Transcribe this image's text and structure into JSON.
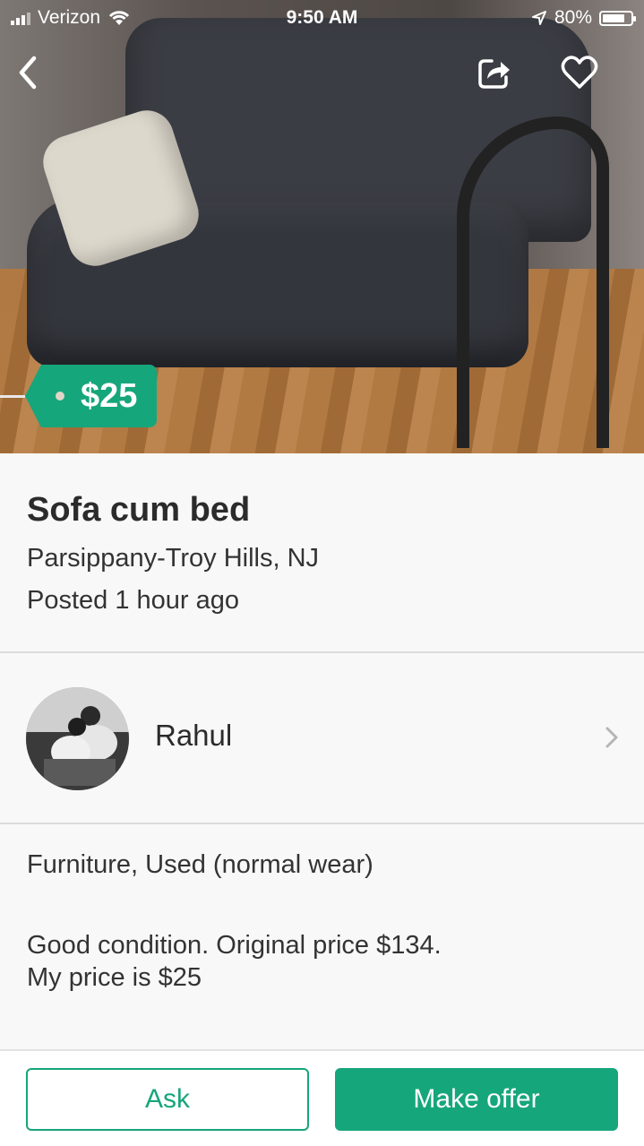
{
  "status_bar": {
    "carrier": "Verizon",
    "time": "9:50 AM",
    "battery_percent": "80%",
    "battery_level": 0.8
  },
  "nav": {
    "back_icon": "chevron-left-icon",
    "share_icon": "share-icon",
    "favorite_icon": "heart-icon"
  },
  "listing": {
    "price": "$25",
    "title": "Sofa cum bed",
    "location": "Parsippany-Troy Hills, NJ",
    "posted": "Posted 1 hour ago",
    "category": "Furniture, Used (normal wear)",
    "description": "Good condition. Original price $134.\nMy price is $25"
  },
  "seller": {
    "name": "Rahul"
  },
  "actions": {
    "ask_label": "Ask",
    "offer_label": "Make offer"
  },
  "colors": {
    "accent": "#16a67b",
    "text": "#2e2e2e",
    "divider": "#dcdcdc",
    "background": "#f8f8f8"
  }
}
